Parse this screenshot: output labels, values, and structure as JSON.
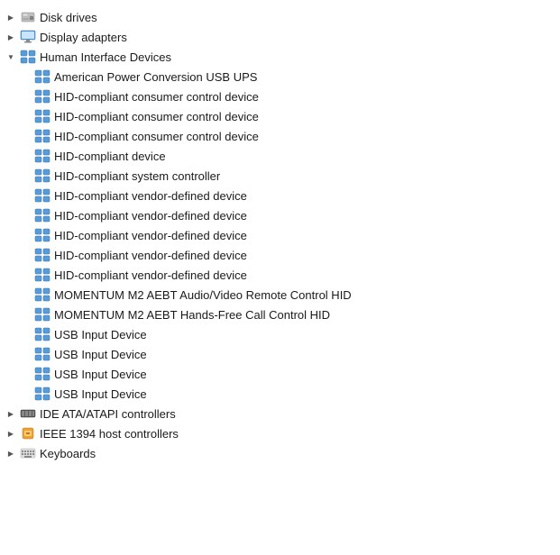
{
  "tree": {
    "items": [
      {
        "id": "disk-drives",
        "level": 0,
        "expand": "collapsed",
        "icon": "disk",
        "label": "Disk drives"
      },
      {
        "id": "display-adapters",
        "level": 0,
        "expand": "collapsed",
        "icon": "display",
        "label": "Display adapters"
      },
      {
        "id": "human-interface-devices",
        "level": 0,
        "expand": "expanded",
        "icon": "hid",
        "label": "Human Interface Devices"
      },
      {
        "id": "american-power",
        "level": 1,
        "expand": "none",
        "icon": "hid",
        "label": "American Power Conversion USB UPS"
      },
      {
        "id": "hid-consumer-1",
        "level": 1,
        "expand": "none",
        "icon": "hid",
        "label": "HID-compliant consumer control device"
      },
      {
        "id": "hid-consumer-2",
        "level": 1,
        "expand": "none",
        "icon": "hid",
        "label": "HID-compliant consumer control device"
      },
      {
        "id": "hid-consumer-3",
        "level": 1,
        "expand": "none",
        "icon": "hid",
        "label": "HID-compliant consumer control device"
      },
      {
        "id": "hid-device",
        "level": 1,
        "expand": "none",
        "icon": "hid",
        "label": "HID-compliant device"
      },
      {
        "id": "hid-system-controller",
        "level": 1,
        "expand": "none",
        "icon": "hid",
        "label": "HID-compliant system controller"
      },
      {
        "id": "hid-vendor-1",
        "level": 1,
        "expand": "none",
        "icon": "hid",
        "label": "HID-compliant vendor-defined device"
      },
      {
        "id": "hid-vendor-2",
        "level": 1,
        "expand": "none",
        "icon": "hid",
        "label": "HID-compliant vendor-defined device"
      },
      {
        "id": "hid-vendor-3",
        "level": 1,
        "expand": "none",
        "icon": "hid",
        "label": "HID-compliant vendor-defined device"
      },
      {
        "id": "hid-vendor-4",
        "level": 1,
        "expand": "none",
        "icon": "hid",
        "label": "HID-compliant vendor-defined device"
      },
      {
        "id": "hid-vendor-5",
        "level": 1,
        "expand": "none",
        "icon": "hid",
        "label": "HID-compliant vendor-defined device"
      },
      {
        "id": "momentum-m2-audio",
        "level": 1,
        "expand": "none",
        "icon": "hid",
        "label": "MOMENTUM M2 AEBT Audio/Video Remote Control HID"
      },
      {
        "id": "momentum-m2-hands",
        "level": 1,
        "expand": "none",
        "icon": "hid",
        "label": "MOMENTUM M2 AEBT Hands-Free Call Control HID"
      },
      {
        "id": "usb-input-1",
        "level": 1,
        "expand": "none",
        "icon": "hid",
        "label": "USB Input Device"
      },
      {
        "id": "usb-input-2",
        "level": 1,
        "expand": "none",
        "icon": "hid",
        "label": "USB Input Device"
      },
      {
        "id": "usb-input-3",
        "level": 1,
        "expand": "none",
        "icon": "hid",
        "label": "USB Input Device"
      },
      {
        "id": "usb-input-4",
        "level": 1,
        "expand": "none",
        "icon": "hid",
        "label": "USB Input Device"
      },
      {
        "id": "ide-ata",
        "level": 0,
        "expand": "collapsed",
        "icon": "ide",
        "label": "IDE ATA/ATAPI controllers"
      },
      {
        "id": "ieee-1394",
        "level": 0,
        "expand": "collapsed",
        "icon": "ieee",
        "label": "IEEE 1394 host controllers"
      },
      {
        "id": "keyboards",
        "level": 0,
        "expand": "collapsed",
        "icon": "keyboard",
        "label": "Keyboards"
      }
    ]
  }
}
